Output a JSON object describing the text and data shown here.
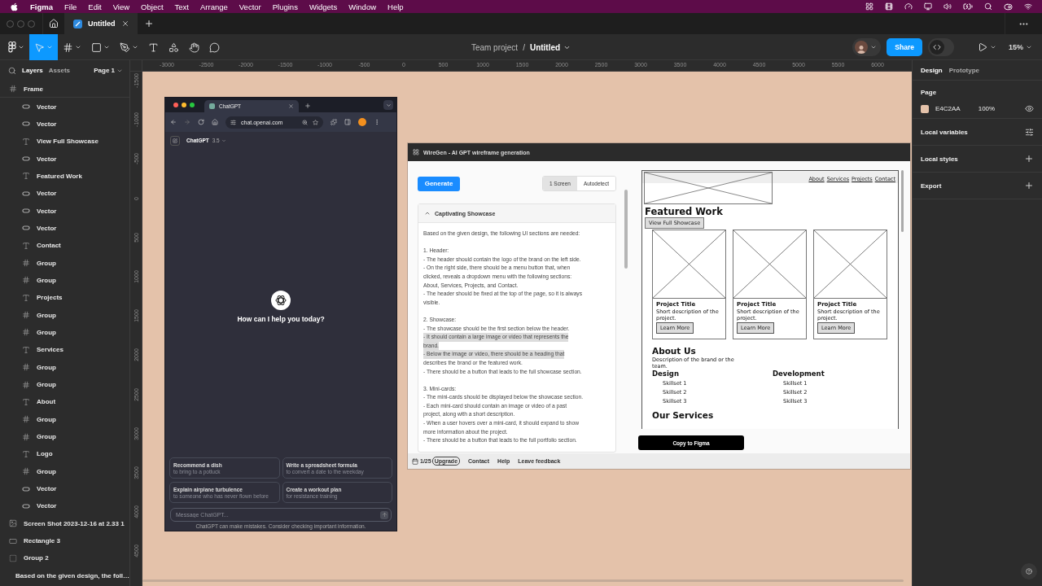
{
  "menu_bar": {
    "app": "Figma",
    "items": [
      "File",
      "Edit",
      "View",
      "Object",
      "Text",
      "Arrange",
      "Vector",
      "Plugins",
      "Widgets",
      "Window",
      "Help"
    ]
  },
  "tab_bar": {
    "tabs": [
      {
        "label": "Untitled",
        "selected": true
      }
    ]
  },
  "toolbar": {
    "tools": [
      {
        "kind": "main-menu",
        "selected": false,
        "caret": true
      },
      {
        "kind": "move",
        "selected": true,
        "caret": true
      },
      {
        "kind": "frame",
        "selected": false,
        "caret": true
      },
      {
        "kind": "shape",
        "selected": false,
        "caret": true
      },
      {
        "kind": "pen",
        "selected": false,
        "caret": true
      },
      {
        "kind": "text",
        "selected": false,
        "caret": false
      },
      {
        "kind": "actions",
        "selected": false,
        "caret": false
      },
      {
        "kind": "hand",
        "selected": false,
        "caret": false
      },
      {
        "kind": "comment",
        "selected": false,
        "caret": false
      }
    ],
    "breadcrumb": {
      "project": "Team project",
      "separator": "/",
      "file": "Untitled"
    },
    "share": "Share",
    "dev_mode": {
      "on": false
    },
    "zoom": "15%"
  },
  "layers_panel": {
    "tabs": [
      {
        "label": "Layers",
        "selected": true
      },
      {
        "label": "Assets",
        "selected": false
      }
    ],
    "page": "Page 1",
    "layers": [
      {
        "name": "Frame",
        "kind": "frame",
        "children": [
          {
            "name": "Vector",
            "kind": "vector"
          },
          {
            "name": "Vector",
            "kind": "vector"
          },
          {
            "name": "View Full Showcase",
            "kind": "text"
          },
          {
            "name": "Vector",
            "kind": "vector"
          },
          {
            "name": "Featured Work",
            "kind": "text"
          },
          {
            "name": "Vector",
            "kind": "vector"
          },
          {
            "name": "Vector",
            "kind": "vector"
          },
          {
            "name": "Vector",
            "kind": "vector"
          },
          {
            "name": "Contact",
            "kind": "text"
          },
          {
            "name": "Group",
            "kind": "frame"
          },
          {
            "name": "Group",
            "kind": "frame"
          },
          {
            "name": "Projects",
            "kind": "text"
          },
          {
            "name": "Group",
            "kind": "frame"
          },
          {
            "name": "Group",
            "kind": "frame"
          },
          {
            "name": "Services",
            "kind": "text"
          },
          {
            "name": "Group",
            "kind": "frame"
          },
          {
            "name": "Group",
            "kind": "frame"
          },
          {
            "name": "About",
            "kind": "text"
          },
          {
            "name": "Group",
            "kind": "frame"
          },
          {
            "name": "Group",
            "kind": "frame"
          },
          {
            "name": "Logo",
            "kind": "text"
          },
          {
            "name": "Group",
            "kind": "frame"
          },
          {
            "name": "Vector",
            "kind": "vector"
          },
          {
            "name": "Vector",
            "kind": "vector"
          }
        ]
      },
      {
        "name": "Screen Shot 2023-12-16 at 2.33 1",
        "kind": "image"
      },
      {
        "name": "Rectangle 3",
        "kind": "rectangle"
      },
      {
        "name": "Group 2",
        "kind": "group"
      },
      {
        "name": "Based on the given design, the foll…",
        "kind": "text"
      }
    ]
  },
  "rulers": {
    "horizontal": [
      "-3000",
      "-2500",
      "-2000",
      "-1500",
      "-1000",
      "-500",
      "0",
      "500",
      "1000",
      "1500",
      "2000",
      "2500",
      "3000",
      "3500",
      "4000",
      "4500",
      "5000",
      "5500",
      "6000"
    ],
    "vertical": [
      "-1500",
      "-1000",
      "-500",
      "0",
      "500",
      "1000",
      "1500",
      "2000",
      "2500",
      "3000",
      "3500",
      "4000",
      "4500"
    ]
  },
  "canvas": {
    "chatgpt_window": {
      "tab": "ChatGPT",
      "url": "chat.openai.com",
      "model": {
        "name": "ChatGPT",
        "version": "3.5"
      },
      "greeting": "How can I help you today?",
      "suggestions": [
        {
          "title": "Recommend a dish",
          "subtitle": "to bring to a potluck"
        },
        {
          "title": "Write a spreadsheet formula",
          "subtitle": "to convert a date to the weekday"
        },
        {
          "title": "Explain airplane turbulence",
          "subtitle": "to someone who has never flown before"
        },
        {
          "title": "Create a workout plan",
          "subtitle": "for resistance training"
        }
      ],
      "input": {
        "placeholder": "Message ChatGPT..."
      },
      "disclaimer": "ChatGPT can make mistakes. Consider checking important information."
    },
    "wiregen": {
      "title": "WireGen - AI GPT wireframe generation",
      "generate": "Generate",
      "modes": [
        {
          "label": "1 Screen",
          "selected": true
        },
        {
          "label": "Autodetect",
          "selected": false
        }
      ],
      "section": {
        "title": "Captivating Showcase",
        "expanded": true,
        "paragraphs": [
          [
            {
              "text": "Based on the given design, the following UI sections are needed:",
              "highlighted": false
            }
          ],
          [
            {
              "text": "1. Header:",
              "highlighted": false
            },
            {
              "text": "- The header should contain the logo of the brand on the left side.",
              "highlighted": false
            },
            {
              "text": "- On the right side, there should be a menu button that, when",
              "highlighted": false
            },
            {
              "text": "clicked, reveals a dropdown menu with the following sections:",
              "highlighted": false
            },
            {
              "text": "About, Services, Projects, and Contact.",
              "highlighted": false
            },
            {
              "text": "- The header should be fixed at the top of the page, so it is always",
              "highlighted": false
            },
            {
              "text": "visible.",
              "highlighted": false
            }
          ],
          [
            {
              "text": "2. Showcase:",
              "highlighted": false
            },
            {
              "text": "- The showcase should be the first section below the header.",
              "highlighted": false
            },
            {
              "text": "- It should contain a large image or video that represents the",
              "highlighted": true
            },
            {
              "text": "brand.",
              "highlighted": true
            },
            {
              "text": "- Below the image or video, there should be a heading that",
              "highlighted": true
            },
            {
              "text": "describes the brand or the featured work.",
              "highlighted": false
            },
            {
              "text": "- There should be a button that leads to the full showcase section.",
              "highlighted": false
            }
          ],
          [
            {
              "text": "3. Mini-cards:",
              "highlighted": false
            },
            {
              "text": "- The mini-cards should be displayed below the showcase section.",
              "highlighted": false
            },
            {
              "text": "- Each mini-card should contain an image or video of a past",
              "highlighted": false
            },
            {
              "text": "project, along with a short description.",
              "highlighted": false
            },
            {
              "text": "- When a user hovers over a mini-card, it should expand to show",
              "highlighted": false
            },
            {
              "text": "more information about the project.",
              "highlighted": false
            },
            {
              "text": "- There should be a button that leads to the full portfolio section.",
              "highlighted": false
            }
          ]
        ]
      },
      "preview": {
        "nav": [
          "About",
          "Services",
          "Projects",
          "Contact"
        ],
        "heading": "Featured Work",
        "showcase_button": "View Full Showcase",
        "cards": [
          {
            "title": "Project Title",
            "description": "Short description of the project.",
            "button": "Learn More"
          },
          {
            "title": "Project Title",
            "description": "Short description of the project.",
            "button": "Learn More"
          },
          {
            "title": "Project Title",
            "description": "Short description of the project.",
            "button": "Learn More"
          }
        ],
        "about": {
          "heading": "About Us",
          "description": "Description of the brand or the team.",
          "columns": [
            {
              "heading": "Design",
              "items": [
                "Skillset 1",
                "Skillset 2",
                "Skillset 3"
              ]
            },
            {
              "heading": "Development",
              "items": [
                "Skillset 1",
                "Skillset 2",
                "Skillset 3"
              ]
            }
          ]
        },
        "services_heading": "Our Services"
      },
      "copy_button": "Copy to Figma",
      "footer": {
        "count": "1/25",
        "upgrade": "Upgrade",
        "links": [
          "Contact",
          "Help",
          "Leave feedback"
        ]
      }
    }
  },
  "design_panel": {
    "tabs": [
      {
        "label": "Design",
        "selected": true
      },
      {
        "label": "Prototype",
        "selected": false
      }
    ],
    "page_heading": "Page",
    "background": {
      "hex": "E4C2AA",
      "opacity": "100%"
    },
    "sections": [
      {
        "label": "Local variables",
        "kind": "variables"
      },
      {
        "label": "Local styles",
        "kind": "add"
      },
      {
        "label": "Export",
        "kind": "add"
      }
    ]
  }
}
